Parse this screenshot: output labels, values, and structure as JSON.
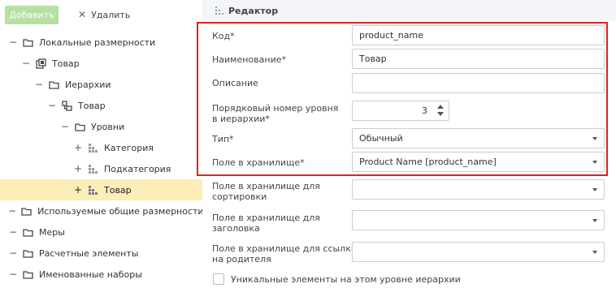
{
  "toolbar": {
    "add_label": "Добавить",
    "delete_label": "Удалить",
    "delete_icon": "close-icon"
  },
  "tree": {
    "items": [
      {
        "label": "Локальные размерности",
        "toggle": "−",
        "icon": "folder-icon"
      },
      {
        "label": "Товар",
        "toggle": "−",
        "icon": "dimension-icon"
      },
      {
        "label": "Иерархии",
        "toggle": "−",
        "icon": "folder-icon"
      },
      {
        "label": "Товар",
        "toggle": "−",
        "icon": "hierarchy-icon"
      },
      {
        "label": "Уровни",
        "toggle": "−",
        "icon": "folder-icon"
      },
      {
        "label": "Категория",
        "toggle": "+",
        "icon": "level-icon"
      },
      {
        "label": "Подкатегория",
        "toggle": "+",
        "icon": "level-icon"
      },
      {
        "label": "Товар",
        "toggle": "+",
        "icon": "level-icon",
        "selected": true
      },
      {
        "label": "Используемые общие размерности",
        "toggle": "−",
        "icon": "folder-icon"
      },
      {
        "label": "Меры",
        "toggle": "−",
        "icon": "folder-icon"
      },
      {
        "label": "Расчетные элементы",
        "toggle": "−",
        "icon": "folder-icon"
      },
      {
        "label": "Именованные наборы",
        "toggle": "−",
        "icon": "folder-icon"
      }
    ]
  },
  "editor": {
    "title": "Редактор",
    "fields": {
      "code": {
        "label": "Код*",
        "value": "product_name"
      },
      "name": {
        "label": "Наименование*",
        "value": "Товар"
      },
      "description": {
        "label": "Описание",
        "value": ""
      },
      "level_number": {
        "label": "Порядковый номер уровня в иерархии*",
        "value": "3"
      },
      "type": {
        "label": "Тип*",
        "value": "Обычный"
      },
      "storage_field": {
        "label": "Поле в хранилище*",
        "value": "Product Name [product_name]"
      },
      "sort_field": {
        "label": "Поле в хранилище для сортировки",
        "value": ""
      },
      "caption_field": {
        "label": "Поле в хранилище для заголовка",
        "value": ""
      },
      "parent_field": {
        "label": "Поле в хранилище для ссылки на родителя",
        "value": ""
      }
    },
    "unique_checkbox": {
      "label": "Уникальные элементы на этом уровне иерархии",
      "checked": false
    }
  },
  "colors": {
    "add_button": "#b5dfa4",
    "selected_row": "#fbeeb6",
    "highlight_border": "#e02020",
    "header_bg": "#f3f5f8"
  }
}
